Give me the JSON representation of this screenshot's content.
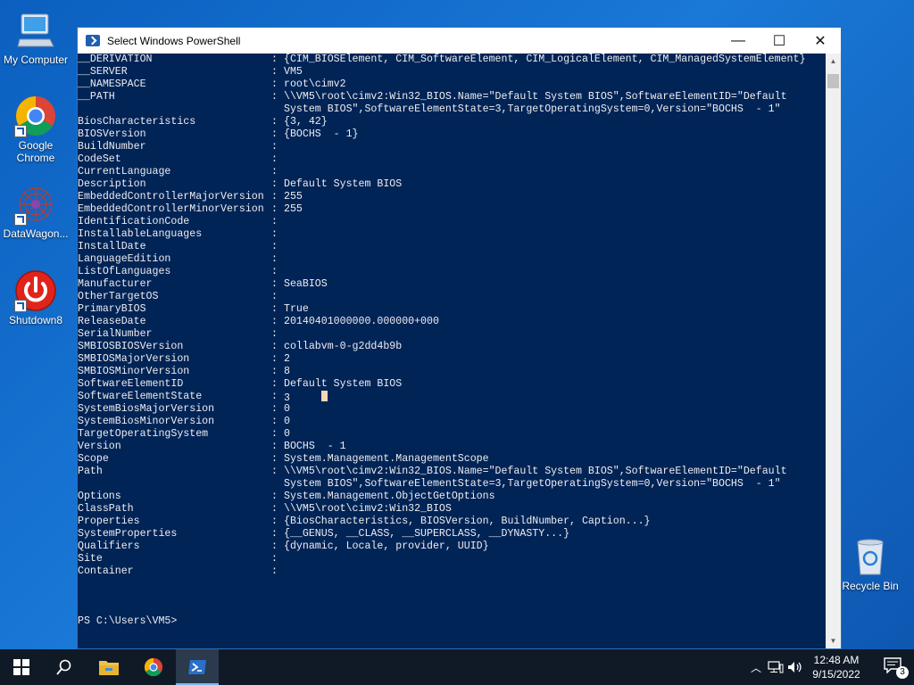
{
  "desktop": {
    "icons": [
      {
        "label": "My Computer"
      },
      {
        "label": "Google Chrome"
      },
      {
        "label": "DataWagon..."
      },
      {
        "label": "Shutdown8"
      },
      {
        "label": "Recycle Bin"
      }
    ]
  },
  "window": {
    "title": "Select Windows PowerShell",
    "minimize_glyph": "—",
    "maximize_glyph": "☐",
    "close_glyph": "✕"
  },
  "console": {
    "rows": [
      {
        "key": "__DERIVATION",
        "value": "{CIM_BIOSElement, CIM_SoftwareElement, CIM_LogicalElement, CIM_ManagedSystemElement}"
      },
      {
        "key": "__SERVER",
        "value": "VM5"
      },
      {
        "key": "__NAMESPACE",
        "value": "root\\cimv2"
      },
      {
        "key": "__PATH",
        "value": "\\\\VM5\\root\\cimv2:Win32_BIOS.Name=\"Default System BIOS\",SoftwareElementID=\"Default"
      },
      {
        "key": "",
        "value": "System BIOS\",SoftwareElementState=3,TargetOperatingSystem=0,Version=\"BOCHS  - 1\""
      },
      {
        "key": "BiosCharacteristics",
        "value": "{3, 42}"
      },
      {
        "key": "BIOSVersion",
        "value": "{BOCHS  - 1}"
      },
      {
        "key": "BuildNumber",
        "value": ""
      },
      {
        "key": "CodeSet",
        "value": ""
      },
      {
        "key": "CurrentLanguage",
        "value": ""
      },
      {
        "key": "Description",
        "value": "Default System BIOS"
      },
      {
        "key": "EmbeddedControllerMajorVersion",
        "value": "255"
      },
      {
        "key": "EmbeddedControllerMinorVersion",
        "value": "255"
      },
      {
        "key": "IdentificationCode",
        "value": ""
      },
      {
        "key": "InstallableLanguages",
        "value": ""
      },
      {
        "key": "InstallDate",
        "value": ""
      },
      {
        "key": "LanguageEdition",
        "value": ""
      },
      {
        "key": "ListOfLanguages",
        "value": ""
      },
      {
        "key": "Manufacturer",
        "value": "SeaBIOS"
      },
      {
        "key": "OtherTargetOS",
        "value": ""
      },
      {
        "key": "PrimaryBIOS",
        "value": "True"
      },
      {
        "key": "ReleaseDate",
        "value": "20140401000000.000000+000"
      },
      {
        "key": "SerialNumber",
        "value": ""
      },
      {
        "key": "SMBIOSBIOSVersion",
        "value": "collabvm-0-g2dd4b9b"
      },
      {
        "key": "SMBIOSMajorVersion",
        "value": "2"
      },
      {
        "key": "SMBIOSMinorVersion",
        "value": "8"
      },
      {
        "key": "SoftwareElementID",
        "value": "Default System BIOS"
      },
      {
        "key": "SoftwareElementState",
        "value": "3",
        "cursor": true
      },
      {
        "key": "SystemBiosMajorVersion",
        "value": "0"
      },
      {
        "key": "SystemBiosMinorVersion",
        "value": "0"
      },
      {
        "key": "TargetOperatingSystem",
        "value": "0"
      },
      {
        "key": "Version",
        "value": "BOCHS  - 1"
      },
      {
        "key": "Scope",
        "value": "System.Management.ManagementScope"
      },
      {
        "key": "Path",
        "value": "\\\\VM5\\root\\cimv2:Win32_BIOS.Name=\"Default System BIOS\",SoftwareElementID=\"Default"
      },
      {
        "key": "",
        "value": "System BIOS\",SoftwareElementState=3,TargetOperatingSystem=0,Version=\"BOCHS  - 1\""
      },
      {
        "key": "Options",
        "value": "System.Management.ObjectGetOptions"
      },
      {
        "key": "ClassPath",
        "value": "\\\\VM5\\root\\cimv2:Win32_BIOS"
      },
      {
        "key": "Properties",
        "value": "{BiosCharacteristics, BIOSVersion, BuildNumber, Caption...}"
      },
      {
        "key": "SystemProperties",
        "value": "{__GENUS, __CLASS, __SUPERCLASS, __DYNASTY...}"
      },
      {
        "key": "Qualifiers",
        "value": "{dynamic, Locale, provider, UUID}"
      },
      {
        "key": "Site",
        "value": ""
      },
      {
        "key": "Container",
        "value": ""
      }
    ],
    "separator": ":",
    "prompt": "PS C:\\Users\\VM5>"
  },
  "taskbar": {
    "apps": [
      {
        "icon": "windows-start-icon"
      },
      {
        "icon": "search-icon"
      },
      {
        "icon": "file-explorer-icon"
      },
      {
        "icon": "chrome-icon"
      },
      {
        "icon": "powershell-icon"
      }
    ],
    "time": "12:48 AM",
    "date": "9/15/2022",
    "notification_count": "3"
  }
}
